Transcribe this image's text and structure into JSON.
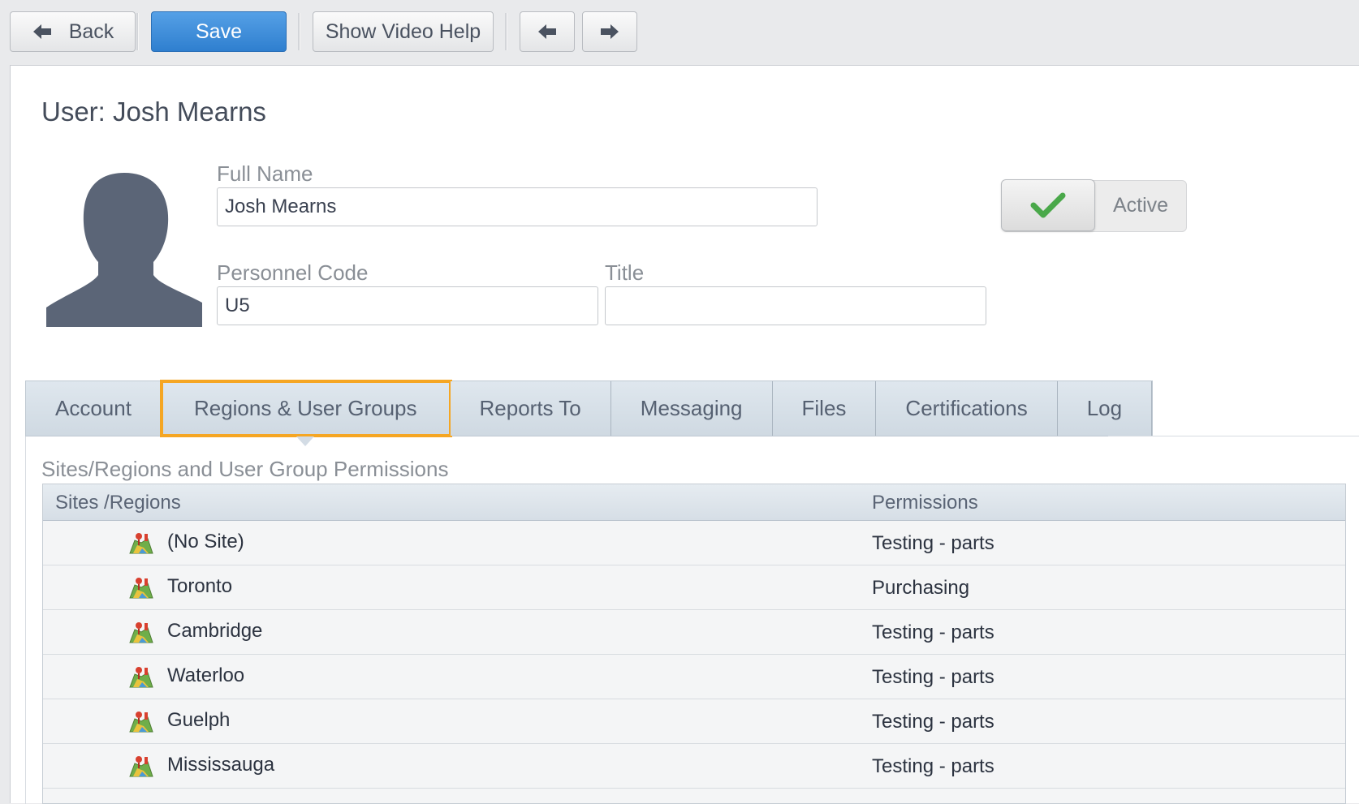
{
  "toolbar": {
    "back_label": "Back",
    "save_label": "Save",
    "video_help_label": "Show Video Help"
  },
  "page": {
    "title": "User: Josh Mearns"
  },
  "form": {
    "full_name_label": "Full Name",
    "full_name_value": "Josh Mearns",
    "personnel_code_label": "Personnel Code",
    "personnel_code_value": "U5",
    "title_label": "Title",
    "title_value": "",
    "active_label": "Active",
    "active": true
  },
  "tabs": [
    {
      "label": "Account"
    },
    {
      "label": "Regions & User Groups",
      "active": true
    },
    {
      "label": "Reports To"
    },
    {
      "label": "Messaging"
    },
    {
      "label": "Files"
    },
    {
      "label": "Certifications"
    },
    {
      "label": "Log"
    }
  ],
  "permissions": {
    "section_title": "Sites/Regions and User Group Permissions",
    "columns": [
      "Sites /Regions",
      "Permissions"
    ],
    "rows": [
      {
        "site": "(No Site)",
        "permission": "Testing - parts"
      },
      {
        "site": "Toronto",
        "permission": "Purchasing"
      },
      {
        "site": "Cambridge",
        "permission": "Testing - parts"
      },
      {
        "site": "Waterloo",
        "permission": "Testing - parts"
      },
      {
        "site": "Guelph",
        "permission": "Testing - parts"
      },
      {
        "site": "Mississauga",
        "permission": "Testing - parts"
      }
    ]
  },
  "colors": {
    "primary_button": "#2f7fcf",
    "active_tab_highlight": "#f5a623",
    "check_green": "#4aa84a"
  },
  "icons": [
    "left-arrow-icon",
    "right-arrow-icon",
    "user-avatar-icon",
    "checkmark-icon",
    "site-map-icon"
  ]
}
